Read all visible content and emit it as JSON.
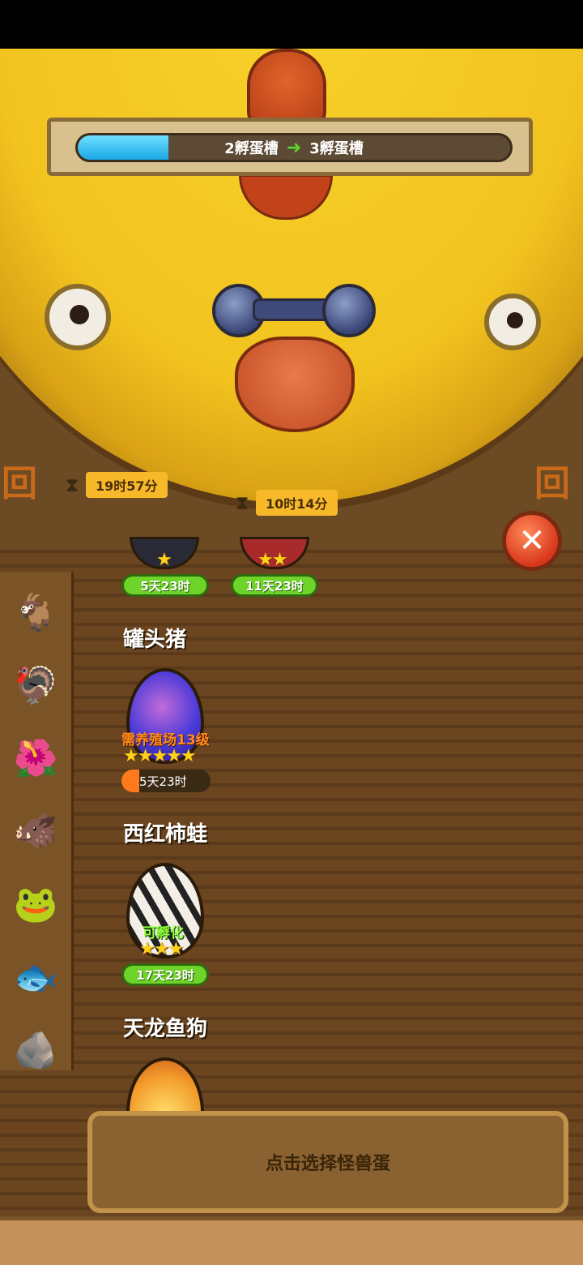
{
  "progress": {
    "from_label": "2孵蛋槽",
    "to_label": "3孵蛋槽",
    "arrow_icon": "arrow-right-icon",
    "fill_fraction": 0.21
  },
  "timers": [
    {
      "label": "19时57分"
    },
    {
      "label": "10时14分"
    }
  ],
  "top_eggs": [
    {
      "stars": "★",
      "time": "5天23时"
    },
    {
      "stars": "★★",
      "time": "11天23时"
    }
  ],
  "sections": [
    {
      "name": "罐头猪",
      "egg_note": "需养殖场13级",
      "stars": "★★★★★",
      "time": "5天23时"
    },
    {
      "name": "西红柿蛙",
      "egg_note": "可孵化",
      "stars": "★★★",
      "time": "17天23时"
    },
    {
      "name": "天龙鱼狗"
    }
  ],
  "sidebar": [
    {
      "icon": "goat-monster-icon"
    },
    {
      "icon": "red-beak-monster-icon"
    },
    {
      "icon": "pink-flower-monster-icon"
    },
    {
      "icon": "armored-pig-icon"
    },
    {
      "icon": "red-frog-icon"
    },
    {
      "icon": "cyan-fish-icon"
    },
    {
      "icon": "rock-dog-icon"
    }
  ],
  "select_panel": {
    "label": "点击选择怪兽蛋"
  },
  "colors": {
    "accent_green": "#6ed42a",
    "timer_yellow": "#f7b92a",
    "progress_blue": "#1aa8e6"
  }
}
